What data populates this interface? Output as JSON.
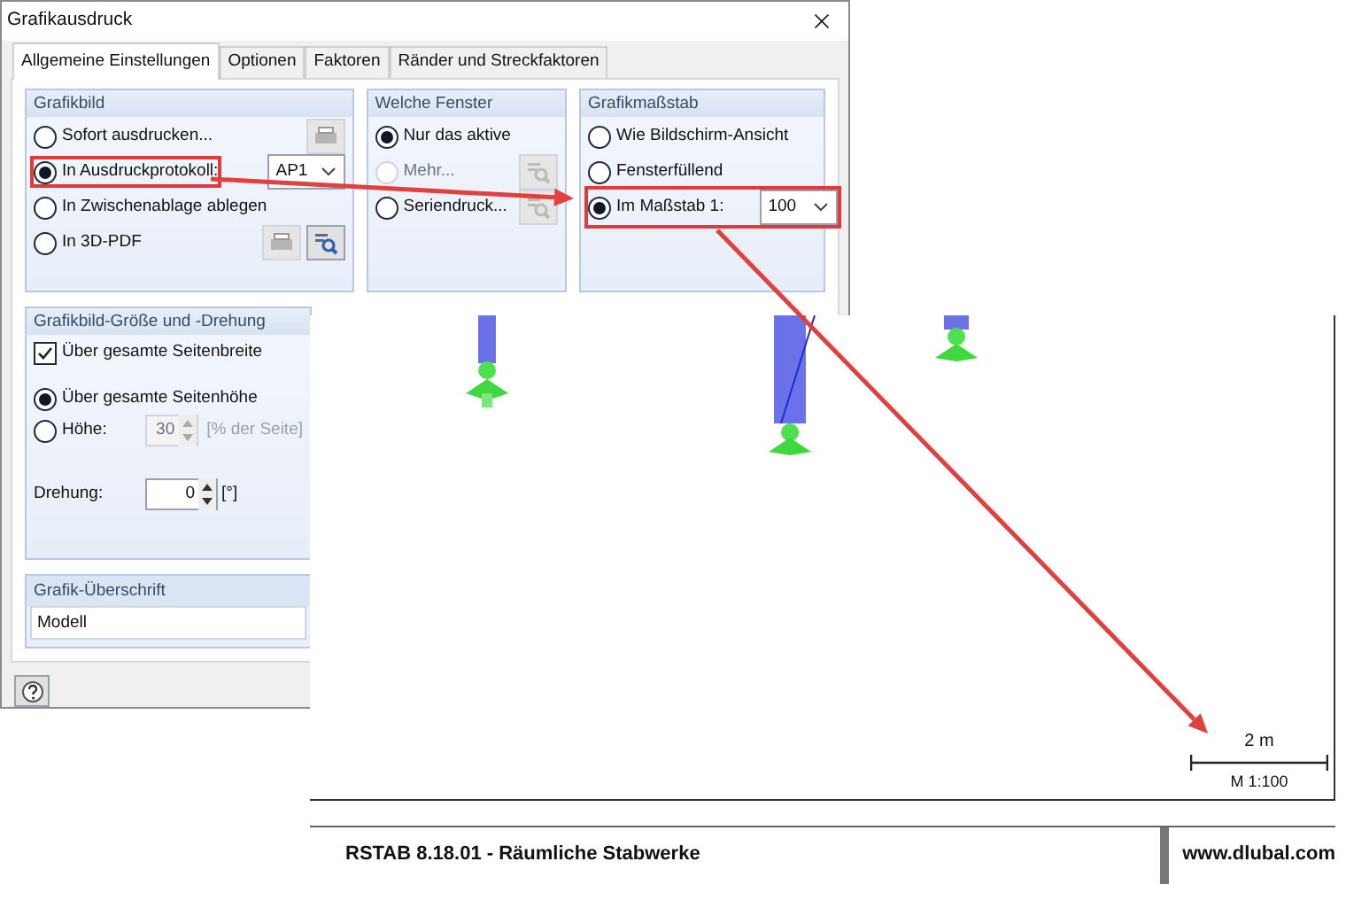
{
  "window": {
    "title": "Grafikausdruck"
  },
  "tabs": [
    {
      "label": "Allgemeine Einstellungen",
      "selected": true
    },
    {
      "label": "Optionen",
      "selected": false
    },
    {
      "label": "Faktoren",
      "selected": false
    },
    {
      "label": "Ränder und Streckfaktoren",
      "selected": false
    }
  ],
  "grafikbild": {
    "title": "Grafikbild",
    "options": [
      {
        "label": "Sofort ausdrucken...",
        "selected": false,
        "highlighted": false,
        "kind": "print"
      },
      {
        "label": "In Ausdruckprotokoll:",
        "selected": true,
        "highlighted": true,
        "kind": "dropdown",
        "value": "AP1"
      },
      {
        "label": "In Zwischenablage ablegen",
        "selected": false,
        "highlighted": false,
        "kind": "plain"
      },
      {
        "label": "In 3D-PDF",
        "selected": false,
        "highlighted": false,
        "kind": "print-preview"
      }
    ]
  },
  "welche_fenster": {
    "title": "Welche Fenster",
    "options": [
      {
        "label": "Nur das aktive",
        "selected": true,
        "disabled": false,
        "kind": "plain"
      },
      {
        "label": "Mehr...",
        "selected": false,
        "disabled": true,
        "kind": "preview"
      },
      {
        "label": "Seriendruck...",
        "selected": false,
        "disabled": false,
        "kind": "preview"
      }
    ]
  },
  "grafikmassstab": {
    "title": "Grafikmaßstab",
    "options": [
      {
        "label": "Wie Bildschirm-Ansicht",
        "selected": false,
        "highlighted": false,
        "kind": "plain"
      },
      {
        "label": "Fensterfüllend",
        "selected": false,
        "highlighted": false,
        "kind": "plain"
      },
      {
        "label": "Im Maßstab 1:",
        "selected": true,
        "highlighted": true,
        "kind": "dropdown",
        "value": "100"
      }
    ]
  },
  "groesse": {
    "title": "Grafikbild-Größe und -Drehung",
    "checkbox": {
      "label": "Über gesamte Seitenbreite",
      "checked": true
    },
    "options": [
      {
        "label": "Über gesamte Seitenhöhe",
        "selected": true,
        "kind": "plain"
      },
      {
        "label": "Höhe:",
        "selected": false,
        "kind": "spin",
        "value": "30",
        "unit": "[% der Seite]"
      }
    ],
    "drehung": {
      "label": "Drehung:",
      "value": "0",
      "unit": "[°]"
    }
  },
  "ueberschrift": {
    "title": "Grafik-Überschrift",
    "value": "Modell"
  },
  "printout": {
    "scale_distance": "2 m",
    "scale": "M 1:100",
    "program": "RSTAB 8.18.01 - Räumliche Stabwerke",
    "website": "www.dlubal.com"
  }
}
